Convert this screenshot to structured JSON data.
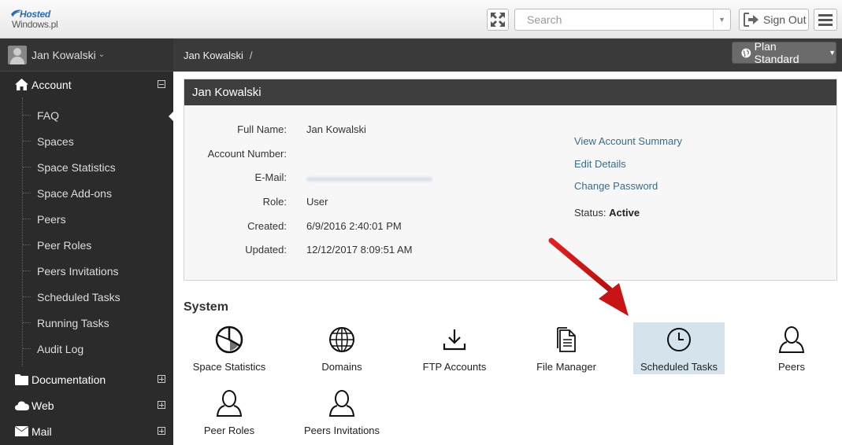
{
  "topbar": {
    "logo_line1": "Hosted",
    "logo_line2": "Windows.pl",
    "search_placeholder": "Search",
    "signout_label": "Sign Out"
  },
  "sidebar": {
    "user_name": "Jan Kowalski",
    "sections": [
      {
        "label": "Account",
        "icon": "home-icon",
        "expanded": true
      },
      {
        "label": "Documentation",
        "icon": "folder-icon",
        "expanded": false
      },
      {
        "label": "Web",
        "icon": "cloud-icon",
        "expanded": false
      },
      {
        "label": "Mail",
        "icon": "envelope-icon",
        "expanded": false
      }
    ],
    "account_items": [
      "FAQ",
      "Spaces",
      "Space Statistics",
      "Space Add-ons",
      "Peers",
      "Peer Roles",
      "Peers Invitations",
      "Scheduled Tasks",
      "Running Tasks",
      "Audit Log"
    ]
  },
  "breadcrumb": {
    "item": "Jan Kowalski",
    "separator": "/"
  },
  "plan_button": "Plan Standard",
  "account_panel": {
    "title": "Jan Kowalski",
    "fields": [
      {
        "label": "Full Name:",
        "value": "Jan Kowalski"
      },
      {
        "label": "Account Number:",
        "value": ""
      },
      {
        "label": "E-Mail:",
        "value": ""
      },
      {
        "label": "Role:",
        "value": "User"
      },
      {
        "label": "Created:",
        "value": "6/9/2016 2:40:01 PM"
      },
      {
        "label": "Updated:",
        "value": "12/12/2017 8:09:51 AM"
      }
    ],
    "links": [
      "View Account Summary",
      "Edit Details",
      "Change Password"
    ],
    "status_label": "Status:",
    "status_value": "Active"
  },
  "system": {
    "title": "System",
    "tiles": [
      {
        "label": "Space Statistics",
        "icon": "pie-chart-icon"
      },
      {
        "label": "Domains",
        "icon": "globe-icon"
      },
      {
        "label": "FTP Accounts",
        "icon": "download-icon"
      },
      {
        "label": "File Manager",
        "icon": "document-icon"
      },
      {
        "label": "Scheduled Tasks",
        "icon": "clock-icon",
        "highlighted": true
      },
      {
        "label": "Peers",
        "icon": "user-icon"
      },
      {
        "label": "Peer Roles",
        "icon": "user-icon"
      },
      {
        "label": "Peers Invitations",
        "icon": "user-icon"
      }
    ]
  },
  "colors": {
    "sidebar_bg": "#2b2b2b",
    "header_bg": "#3e3e3e",
    "link": "#3c6a8a",
    "highlight_tile": "#d4e3ec",
    "arrow": "#d01818"
  }
}
